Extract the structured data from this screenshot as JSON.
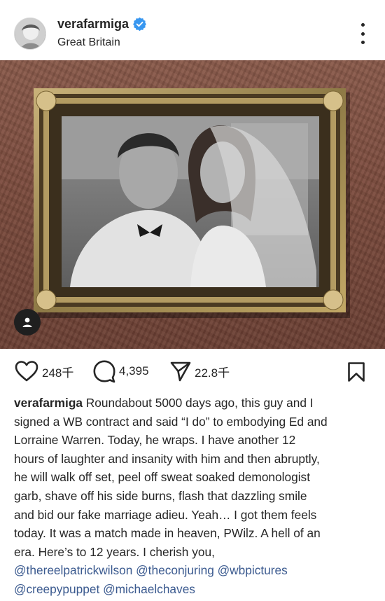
{
  "post": {
    "username": "verafarmiga",
    "location": "Great Britain",
    "verified": true,
    "accent_color": "#3897f0",
    "mention_color": "#3b5a8f"
  },
  "actions": {
    "likes": "248千",
    "comments": "4,395",
    "shares": "22.8千"
  },
  "caption": {
    "lines": [
      "Roundabout 5000 days ago, this guy and I",
      "signed a WB contract and said “I do” to embodying Ed and",
      "Lorraine Warren.  Today, he wraps.  I have another 12",
      "hours of laughter and insanity with him and then abruptly,",
      "he will walk off set, peel off sweat soaked demonologist",
      "garb, shave off his side burns, flash that dazzling smile",
      "and bid our fake marriage adieu.  Yeah… I got them feels",
      "today.  It was a match made in heaven, PWilz.  A hell of an",
      "era.  Here’s to 12 years.  I cherish you,"
    ],
    "mentions": [
      "@thereelpatrickwilson",
      "@theconjuring",
      "@wbpictures",
      "@creepypuppet",
      "@michaelchaves"
    ]
  },
  "icons": {
    "verified": "verified-badge-icon",
    "more": "more-options-icon",
    "tag": "user-tag-icon",
    "like": "heart-icon",
    "comment": "comment-bubble-icon",
    "share": "paper-plane-icon",
    "save": "bookmark-icon"
  }
}
